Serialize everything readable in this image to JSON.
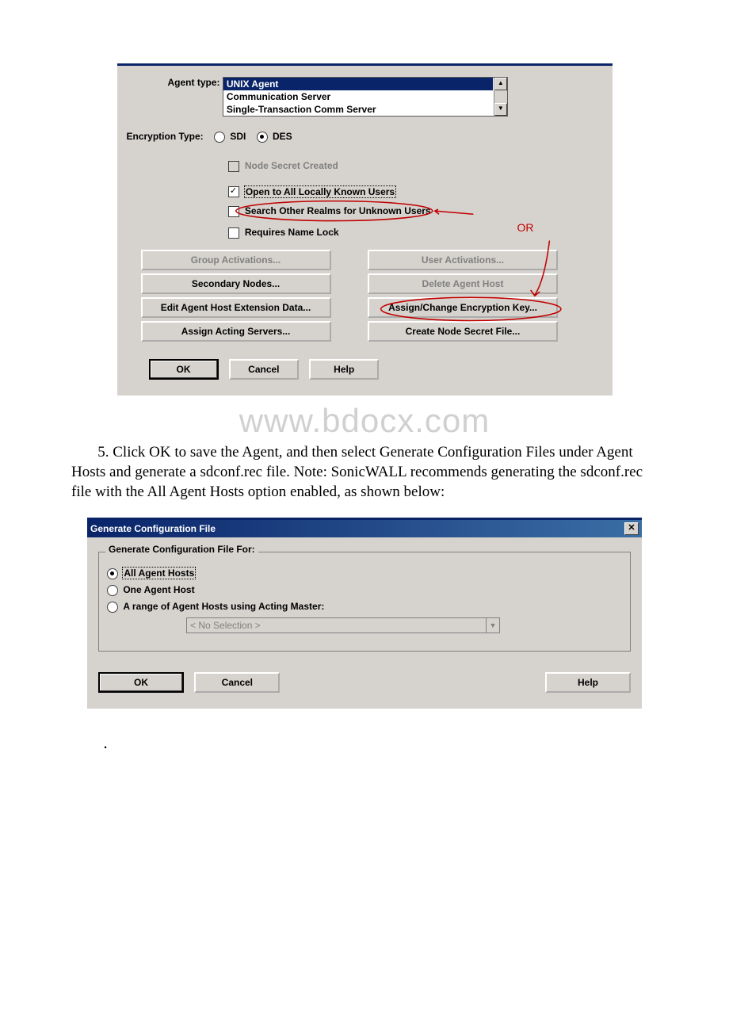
{
  "dialog1": {
    "agent_type_label": "Agent type:",
    "agent_types": [
      "UNIX Agent",
      "Communication Server",
      "Single-Transaction Comm Server"
    ],
    "encryption_label": "Encryption Type:",
    "enc_sdi": "SDI",
    "enc_des": "DES",
    "chk_node_secret": "Node Secret Created",
    "chk_open_all": "Open to All Locally Known Users",
    "chk_search_other": "Search Other Realms for Unknown Users",
    "chk_requires_lock": "Requires Name Lock",
    "annotation_or": "OR",
    "btn_group_activations": "Group Activations...",
    "btn_user_activations": "User Activations...",
    "btn_secondary_nodes": "Secondary Nodes...",
    "btn_delete_agent": "Delete Agent Host",
    "btn_edit_ext": "Edit Agent Host Extension Data...",
    "btn_assign_change": "Assign/Change Encryption Key...",
    "btn_assign_acting": "Assign Acting Servers...",
    "btn_create_node": "Create Node Secret File...",
    "btn_ok": "OK",
    "btn_cancel": "Cancel",
    "btn_help": "Help"
  },
  "watermark": "www.bdocx.com",
  "body_step": "5. Click OK to save the Agent, and then select Generate Configuration Files under Agent Hosts and generate a sdconf.rec file. Note: SonicWALL recommends generating the sdconf.rec file with the All Agent Hosts option enabled, as shown below:",
  "dialog2": {
    "title": "Generate Configuration File",
    "group_title": "Generate Configuration File For:",
    "opt_all": "All Agent Hosts",
    "opt_one": "One Agent Host",
    "opt_range": "A range of Agent Hosts using Acting Master:",
    "no_selection": "< No Selection >",
    "btn_ok": "OK",
    "btn_cancel": "Cancel",
    "btn_help": "Help"
  }
}
